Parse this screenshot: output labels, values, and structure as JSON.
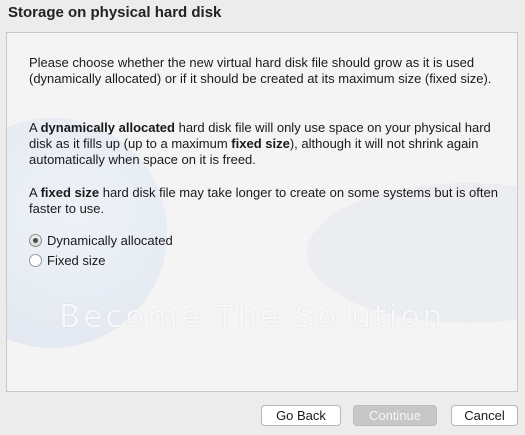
{
  "title": "Storage on physical hard disk",
  "paragraphs": {
    "p1": "Please choose whether the new virtual hard disk file should grow as it is used (dynamically allocated) or if it should be created at its maximum size (fixed size).",
    "p2_a": "A ",
    "p2_b": "dynamically allocated",
    "p2_c": " hard disk file will only use space on your physical hard disk as it fills up (up to a maximum ",
    "p2_d": "fixed size",
    "p2_e": "), although it will not shrink again automatically when space on it is freed.",
    "p3_a": "A ",
    "p3_b": "fixed size",
    "p3_c": " hard disk file may take longer to create on some systems but is often faster to use."
  },
  "options": [
    {
      "label": "Dynamically allocated",
      "selected": true
    },
    {
      "label": "Fixed size",
      "selected": false
    }
  ],
  "watermark": "Become The Solution",
  "buttons": {
    "back": "Go Back",
    "continue": "Continue",
    "cancel": "Cancel"
  }
}
